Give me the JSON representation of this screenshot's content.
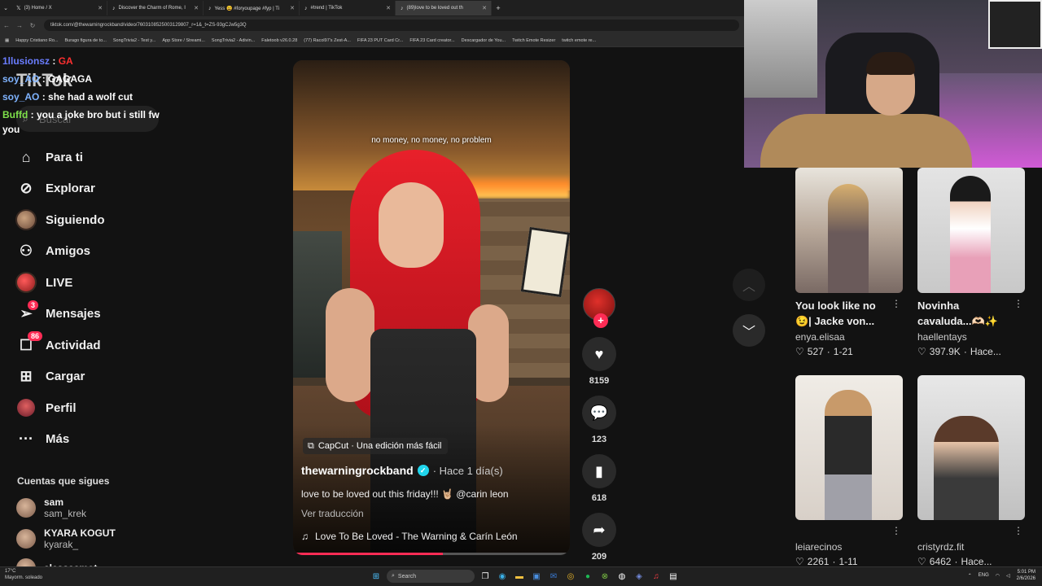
{
  "browser": {
    "tabs": [
      {
        "label": "(3) Home / X",
        "icon": "x-logo-icon",
        "active": false
      },
      {
        "label": "Discover the Charm of Rome, I",
        "icon": "tiktok-icon",
        "active": false
      },
      {
        "label": "Yess 😩 #foryoupage #fyp | Ti",
        "icon": "tiktok-icon",
        "active": false
      },
      {
        "label": "#trend | TikTok",
        "icon": "tiktok-icon",
        "active": false
      },
      {
        "label": "(89)love to be loved out th",
        "icon": "tiktok-icon",
        "active": true
      }
    ],
    "url": "tiktok.com/@thewarningrockband/video/7603108525003129807_r=1&_t=ZS-93gCJw5g3Q",
    "bookmarks": [
      "Happy Cristiano Ro...",
      "Burago figura de to...",
      "SongTrivia2 - Test y...",
      "App Store / Streami...",
      "SongTrivia2 - Adivin...",
      "Faletoob v26.0.28",
      "(77) Racol97's Zest-A...",
      "FIFA 23 PUT Card Cr...",
      "FIFA 23 Card creator...",
      "Descargador de You...",
      "Twitch Emote Resizer",
      "twitch emote re..."
    ]
  },
  "chat": [
    {
      "user": "1llusionsz",
      "message": "GA",
      "color": "#6a7dff"
    },
    {
      "user": "soy_AO",
      "message": "GAGAGA",
      "color": "#7fb3ff"
    },
    {
      "user": "soy_AO",
      "message": "she had a wolf cut",
      "color": "#7fb3ff"
    },
    {
      "user": "Buffd",
      "message": "you a joke bro but i still fw you",
      "color": "#7ee04a"
    }
  ],
  "sidebar": {
    "logo": "TikTok",
    "search_placeholder": "Buscar",
    "items": [
      {
        "label": "Para ti",
        "icon": "home-icon",
        "badge": ""
      },
      {
        "label": "Explorar",
        "icon": "compass-icon",
        "badge": ""
      },
      {
        "label": "Siguiendo",
        "icon": "following-avatar-icon",
        "badge": ""
      },
      {
        "label": "Amigos",
        "icon": "friends-icon",
        "badge": ""
      },
      {
        "label": "LIVE",
        "icon": "live-icon",
        "badge": ""
      },
      {
        "label": "Mensajes",
        "icon": "send-icon",
        "badge": "3"
      },
      {
        "label": "Actividad",
        "icon": "inbox-icon",
        "badge": "86"
      },
      {
        "label": "Cargar",
        "icon": "upload-icon",
        "badge": ""
      },
      {
        "label": "Perfil",
        "icon": "profile-avatar-icon",
        "badge": ""
      },
      {
        "label": "Más",
        "icon": "more-dots-icon",
        "badge": ""
      }
    ],
    "following_title": "Cuentas que sigues",
    "following": [
      {
        "name": "sam",
        "handle": "sam_krek"
      },
      {
        "name": "KYARA KOGUT",
        "handle": "kyarak_"
      },
      {
        "name": "alessaamot",
        "handle": ""
      }
    ]
  },
  "video": {
    "subtitle": "no money, no money, no problem",
    "capcut": "CapCut · Una edición más fácil",
    "author": "thewarningrockband",
    "posted": "· Hace 1 día(s)",
    "caption": "love to be loved out this friday!!! 🤘🏼 @carin leon",
    "translate": "Ver traducción",
    "music": "Love To Be Loved - The Warning & Carín León",
    "progress": 0.54
  },
  "actions": {
    "likes": "8159",
    "comments": "123",
    "saves": "618",
    "shares": "209"
  },
  "recommended": [
    {
      "title": "You look like no 😉| Jacke von...",
      "user": "enya.elisaa",
      "likes": "527",
      "date": "1-21"
    },
    {
      "title": "Novinha cavaluda...🫶🏻✨",
      "user": "haellentays",
      "likes": "397.9K",
      "date": "Hace..."
    },
    {
      "title": "",
      "user": "leiarecinos",
      "likes": "2261",
      "date": "1-11"
    },
    {
      "title": "",
      "user": "cristyrdz.fit",
      "likes": "6462",
      "date": "Hace..."
    }
  ],
  "taskbar": {
    "weather_temp": "17°C",
    "weather_desc": "Mayorm. soleado",
    "search": "Search",
    "lang": "ENG",
    "time": "5:01 PM",
    "date": "2/6/2026"
  },
  "colors": {
    "accent": "#fe2c55",
    "verified": "#20d5ec"
  }
}
